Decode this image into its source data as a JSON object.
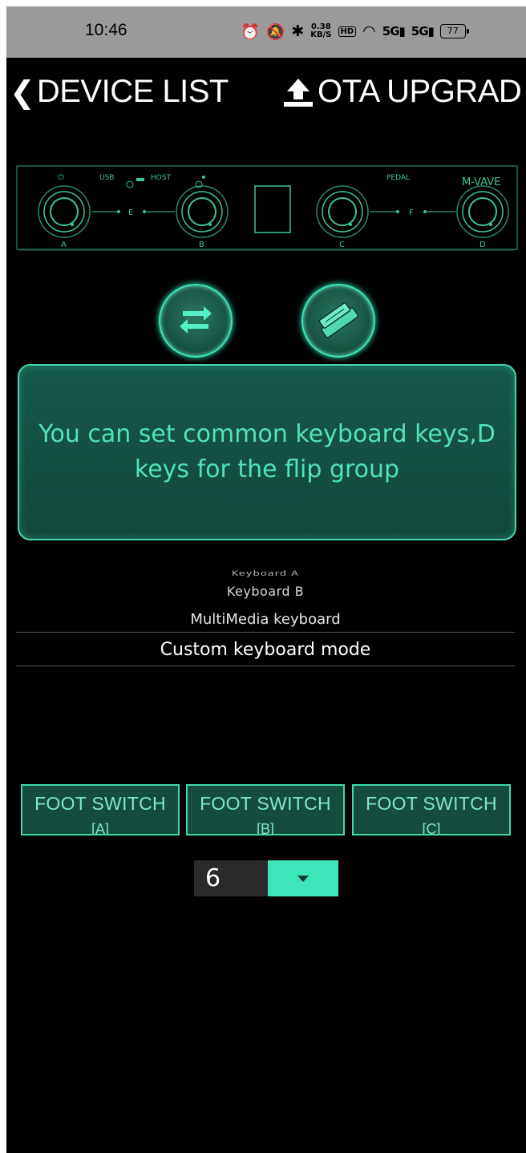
{
  "status_bar": {
    "time": "10:46",
    "net_speed_value": "0.38",
    "net_speed_unit": "KB/S",
    "hd_badge": "HD",
    "signal_1": "5G",
    "signal_2": "5G",
    "battery": "77"
  },
  "header": {
    "back_label": "DEVICE LIST",
    "ota_label": "OTA UPGRAD"
  },
  "device_image": {
    "labels": {
      "usb": "USB",
      "host": "HOST",
      "pedal": "PEDAL",
      "brand": "M-VAVE",
      "knob_a": "A",
      "knob_b": "B",
      "knob_c": "C",
      "knob_d": "D",
      "link_e": "E",
      "link_f": "F"
    }
  },
  "mode_buttons": {
    "swap_icon": "swap-arrows-icon",
    "pedal_icon": "expression-pedal-icon"
  },
  "info_text": "You can set common keyboard keys,D keys for the flip group",
  "keyboard_picker": {
    "options": [
      "Keyboard A",
      "Keyboard B",
      "MultiMedia keyboard",
      "Custom keyboard mode"
    ],
    "selected": "Custom keyboard mode"
  },
  "foot_switches": [
    {
      "label": "FOOT SWITCH",
      "key": "[A]"
    },
    {
      "label": "FOOT SWITCH",
      "key": "[B]"
    },
    {
      "label": "FOOT SWITCH",
      "key": "[C]"
    }
  ],
  "value_select": {
    "value": "6"
  },
  "colors": {
    "accent": "#3de5b9",
    "panel": "#15584a",
    "background": "#000000",
    "statusbar": "#9a9a9a"
  }
}
